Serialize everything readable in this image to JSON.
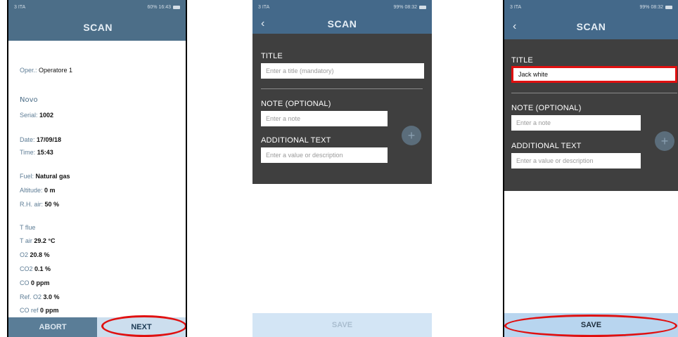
{
  "status": {
    "p1_left": "3 ITA",
    "p1_right": "60% 16:43",
    "p2_left": "3 ITA",
    "p2_right": "99% 08:32",
    "p3_left": "3 ITA",
    "p3_right": "99% 08:32"
  },
  "screen1": {
    "title": "SCAN",
    "oper_label": "Oper.:",
    "oper_value": "Operatore 1",
    "device": "Novo",
    "serial_label": "Serial:",
    "serial_value": "1002",
    "date_label": "Date:",
    "date_value": "17/09/18",
    "time_label": "Time:",
    "time_value": "15:43",
    "fuel_label": "Fuel:",
    "fuel_value": "Natural gas",
    "alt_label": "Altitude:",
    "alt_value": "0 m",
    "rh_label": "R.H. air:",
    "rh_value": "50 %",
    "tflue_label": "T flue",
    "tair_label": "T air",
    "tair_value": "29.2 °C",
    "o2_label": "O2",
    "o2_value": "20.8 %",
    "co2_label": "CO2",
    "co2_value": "0.1 %",
    "co_label": "CO",
    "co_value": "0 ppm",
    "refo2_label": "Ref. O2",
    "refo2_value": "3.0 %",
    "coref_label": "CO ref",
    "coref_value": "0 ppm",
    "abort": "ABORT",
    "next": "NEXT"
  },
  "screen2": {
    "back": "‹",
    "title": "SCAN",
    "title_label": "TITLE",
    "title_placeholder": "Enter a title (mandatory)",
    "note_label": "NOTE (OPTIONAL)",
    "note_placeholder": "Enter a note",
    "additional_label": "ADDITIONAL TEXT",
    "additional_placeholder": "Enter a value or description",
    "plus": "+",
    "save": "SAVE"
  },
  "screen3": {
    "back": "‹",
    "title": "SCAN",
    "title_label": "TITLE",
    "title_value": "Jack white",
    "note_label": "NOTE (OPTIONAL)",
    "note_placeholder": "Enter a note",
    "additional_label": "ADDITIONAL TEXT",
    "additional_placeholder": "Enter a value or description",
    "plus": "+",
    "save": "SAVE"
  },
  "colors": {
    "header": "#4c6e88",
    "form_bg": "#3f3f3f",
    "highlight_red": "#e01010",
    "save_enabled": "#b8d5ef",
    "save_disabled": "#d3e5f5"
  }
}
